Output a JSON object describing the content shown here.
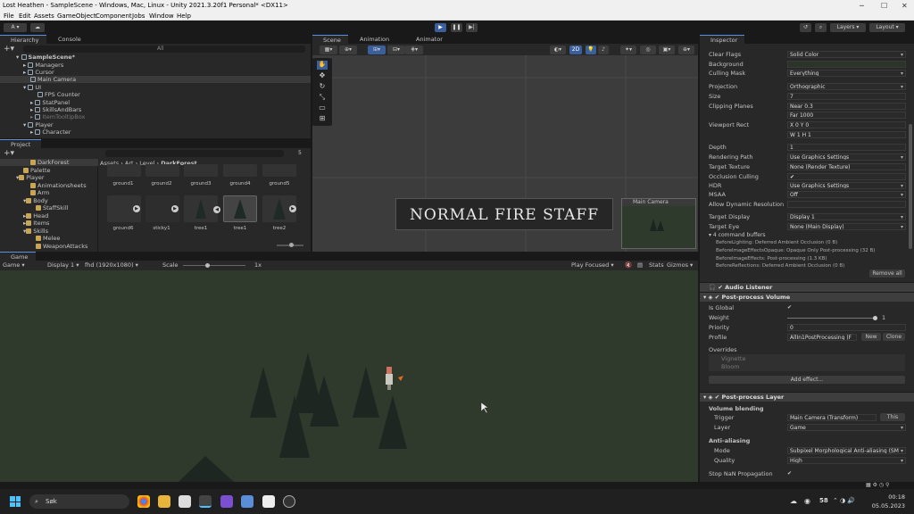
{
  "window": {
    "title": "Lost Heathen - SampleScene - Windows, Mac, Linux - Unity 2021.3.20f1 Personal* <DX11>"
  },
  "menu": [
    "File",
    "Edit",
    "Assets",
    "GameObject",
    "Component",
    "Jobs",
    "Window",
    "Help"
  ],
  "toolbar": {
    "account": "A",
    "layers": "Layers",
    "layout": "Layout"
  },
  "hierarchy": {
    "tab": "Hierarchy",
    "console_tab": "Console",
    "search_placeholder": "All",
    "scene": "SampleScene*",
    "items": [
      "Managers",
      "Cursor",
      "Main Camera",
      "UI",
      "FPS Counter",
      "StatPanel",
      "SkillsAndBars",
      "ItemTooltipBox",
      "Player",
      "Character"
    ]
  },
  "scene_tabs": {
    "scene": "Scene",
    "animation": "Animation",
    "animator": "Animator",
    "zoom": "2D"
  },
  "scene_view": {
    "banner": "NORMAL FIRE STAFF",
    "camera_preview": "Main Camera"
  },
  "project": {
    "tab": "Project",
    "breadcrumb": [
      "Assets",
      "Art",
      "Level",
      "DarkForest"
    ],
    "count": "5",
    "tree": [
      "DarkForest",
      "Palette",
      "Player",
      "Animationsheets",
      "Arm",
      "Body",
      "StaffSkill",
      "Head",
      "Items",
      "Skills",
      "Melee",
      "WeaponAttacks"
    ],
    "assets_row1": [
      "ground1",
      "ground2",
      "ground3",
      "ground4",
      "ground5"
    ],
    "assets_row2": [
      "ground6",
      "sticky1",
      "tree1",
      "tree1",
      "tree2"
    ]
  },
  "game": {
    "tab": "Game",
    "mode": "Game",
    "display": "Display 1",
    "resolution": "fhd (1920x1080)",
    "scale_label": "Scale",
    "scale_value": "1x",
    "play_focused": "Play Focused",
    "stats": "Stats",
    "gizmos": "Gizmos"
  },
  "inspector": {
    "tab": "Inspector",
    "camera": [
      {
        "label": "Clear Flags",
        "value": "Solid Color",
        "dd": true
      },
      {
        "label": "Background",
        "value": "",
        "color": "#2a3528"
      },
      {
        "label": "Culling Mask",
        "value": "Everything",
        "dd": true
      },
      {
        "label": "Projection",
        "value": "Orthographic",
        "dd": true
      },
      {
        "label": "Size",
        "value": "7"
      },
      {
        "label": "Clipping Planes",
        "value": "Near   0.3"
      },
      {
        "label": "",
        "value": "Far     1000"
      },
      {
        "label": "Viewport Rect",
        "value": "X 0            Y 0"
      },
      {
        "label": "",
        "value": "W 1            H 1"
      },
      {
        "label": "Depth",
        "value": "1"
      },
      {
        "label": "Rendering Path",
        "value": "Use Graphics Settings",
        "dd": true
      },
      {
        "label": "Target Texture",
        "value": "None (Render Texture)"
      },
      {
        "label": "Occlusion Culling",
        "value": "✔"
      },
      {
        "label": "HDR",
        "value": "Use Graphics Settings",
        "dd": true
      },
      {
        "label": "MSAA",
        "value": "Off",
        "dd": true
      },
      {
        "label": "Allow Dynamic Resolution",
        "value": ""
      },
      {
        "label": "Target Display",
        "value": "Display 1",
        "dd": true
      },
      {
        "label": "Target Eye",
        "value": "None (Main Display)",
        "dd": true
      }
    ],
    "command_buffers": {
      "title": "4 command buffers",
      "items": [
        "BeforeLighting: Deferred Ambient Occlusion (0 B)",
        "BeforeImageEffectsOpaque: Opaque Only Post-processing (32 B)",
        "BeforeImageEffects: Post-processing (1.3 KB)",
        "BeforeReflections: Deferred Ambient Occlusion (0 B)"
      ],
      "remove": "Remove all"
    },
    "audio_listener": "Audio Listener",
    "ppvolume": {
      "title": "Post-process Volume",
      "is_global": "Is Global",
      "weight_label": "Weight",
      "weight": "1",
      "priority_label": "Priority",
      "priority": "0",
      "profile_label": "Profile",
      "profile": "AllIn1PostProcessing (F",
      "new": "New",
      "clone": "Clone",
      "overrides": "Overrides",
      "vignette": "Vignette",
      "bloom": "Bloom",
      "add_effect": "Add effect..."
    },
    "pplayer": {
      "title": "Post-process Layer",
      "volume_blending": "Volume blending",
      "trigger_label": "Trigger",
      "trigger": "Main Camera (Transform)",
      "this": "This",
      "layer_label": "Layer",
      "layer": "Game",
      "aa": "Anti-aliasing",
      "mode_label": "Mode",
      "mode": "Subpixel Morphological Anti-aliasing (SM",
      "quality_label": "Quality",
      "quality": "High",
      "nan": "Stop NaN Propagation"
    }
  },
  "taskbar": {
    "search": "Søk",
    "temp": "58",
    "time": "00:18",
    "date": "05.05.2023"
  }
}
